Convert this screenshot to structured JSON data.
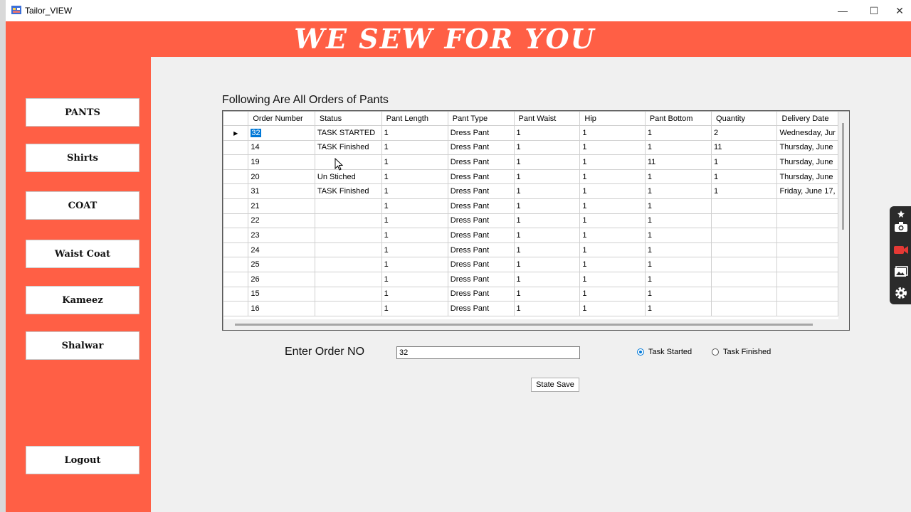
{
  "window": {
    "title": "Tailor_VIEW",
    "controls": {
      "minimize": "—",
      "maximize": "☐",
      "close": "✕"
    }
  },
  "banner": {
    "title": "WE SEW FOR YOU",
    "background": "#ff5f45"
  },
  "sidebar": {
    "items": [
      {
        "label": "PANTS"
      },
      {
        "label": "Shirts"
      },
      {
        "label": "COAT"
      },
      {
        "label": "Waist Coat"
      },
      {
        "label": "Kameez"
      },
      {
        "label": "Shalwar"
      }
    ],
    "logout": "Logout"
  },
  "grid": {
    "caption": "Following Are All Orders of Pants",
    "columns": [
      "Order Number",
      "Status",
      "Pant Length",
      "Pant Type",
      "Pant Waist",
      "Hip",
      "Pant Bottom",
      "Quantity",
      "Delivery Date"
    ],
    "rows": [
      [
        "32",
        "TASK STARTED",
        "1",
        "Dress Pant",
        "1",
        "1",
        "1",
        "2",
        "Wednesday, Jur"
      ],
      [
        "14",
        "TASK Finished",
        "1",
        "Dress Pant",
        "1",
        "1",
        "1",
        "11",
        "Thursday, June "
      ],
      [
        "19",
        "",
        "1",
        "Dress Pant",
        "1",
        "1",
        "11",
        "1",
        "Thursday, June "
      ],
      [
        "20",
        "Un Stiched",
        "1",
        "Dress Pant",
        "1",
        "1",
        "1",
        "1",
        "Thursday, June "
      ],
      [
        "31",
        "TASK Finished",
        "1",
        "Dress Pant",
        "1",
        "1",
        "1",
        "1",
        "Friday, June 17,"
      ],
      [
        "21",
        "",
        "1",
        "Dress Pant",
        "1",
        "1",
        "1",
        "",
        ""
      ],
      [
        "22",
        "",
        "1",
        "Dress Pant",
        "1",
        "1",
        "1",
        "",
        ""
      ],
      [
        "23",
        "",
        "1",
        "Dress Pant",
        "1",
        "1",
        "1",
        "",
        ""
      ],
      [
        "24",
        "",
        "1",
        "Dress Pant",
        "1",
        "1",
        "1",
        "",
        ""
      ],
      [
        "25",
        "",
        "1",
        "Dress Pant",
        "1",
        "1",
        "1",
        "",
        ""
      ],
      [
        "26",
        "",
        "1",
        "Dress Pant",
        "1",
        "1",
        "1",
        "",
        ""
      ],
      [
        "15",
        "",
        "1",
        "Dress Pant",
        "1",
        "1",
        "1",
        "",
        ""
      ],
      [
        "16",
        "",
        "1",
        "Dress Pant",
        "1",
        "1",
        "1",
        "",
        ""
      ]
    ],
    "current_row_marker": "▶"
  },
  "form": {
    "order_label": "Enter Order NO",
    "order_value": "32",
    "radio_started": "Task Started",
    "radio_finished": "Task Finished",
    "save_label": "State Save"
  },
  "overlay": {
    "icons": [
      "pin-icon",
      "camera-icon",
      "video-icon",
      "gallery-icon",
      "settings-icon"
    ],
    "video_color": "#e53935"
  }
}
